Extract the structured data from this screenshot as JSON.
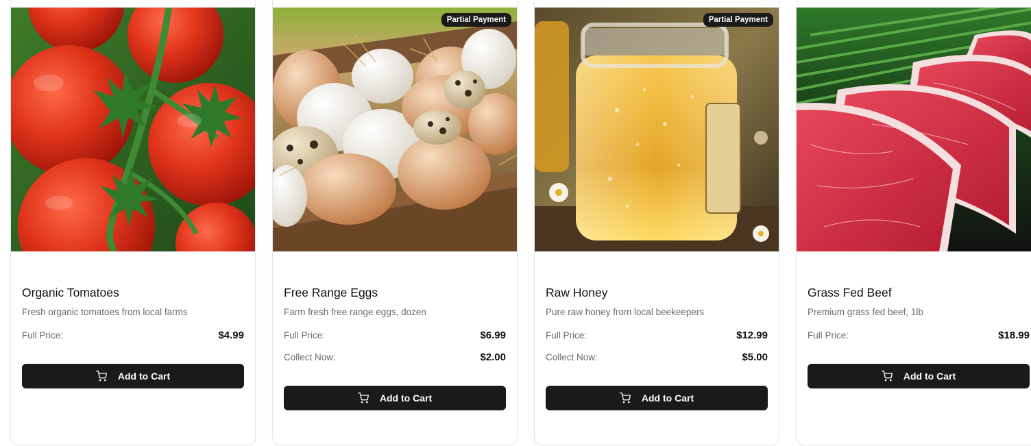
{
  "products": [
    {
      "name": "Organic Tomatoes",
      "description": "Fresh organic tomatoes from local farms",
      "full_price_label": "Full Price:",
      "full_price": "$4.99",
      "badge": null,
      "collect_label": null,
      "collect_now": null,
      "button_label": "Add to Cart",
      "image_icon": "tomatoes-image"
    },
    {
      "name": "Free Range Eggs",
      "description": "Farm fresh free range eggs, dozen",
      "full_price_label": "Full Price:",
      "full_price": "$6.99",
      "badge": "Partial Payment",
      "collect_label": "Collect Now:",
      "collect_now": "$2.00",
      "button_label": "Add to Cart",
      "image_icon": "eggs-image"
    },
    {
      "name": "Raw Honey",
      "description": "Pure raw honey from local beekeepers",
      "full_price_label": "Full Price:",
      "full_price": "$12.99",
      "badge": "Partial Payment",
      "collect_label": "Collect Now:",
      "collect_now": "$5.00",
      "button_label": "Add to Cart",
      "image_icon": "honey-image"
    },
    {
      "name": "Grass Fed Beef",
      "description": "Premium grass fed beef, 1lb",
      "full_price_label": "Full Price:",
      "full_price": "$18.99",
      "badge": null,
      "collect_label": null,
      "collect_now": null,
      "button_label": "Add to Cart",
      "image_icon": "beef-image"
    }
  ],
  "colors": {
    "button_bg": "#1a1a1a",
    "badge_bg": "#1a1a1a",
    "title": "#111111",
    "muted": "#6b6b6b"
  }
}
